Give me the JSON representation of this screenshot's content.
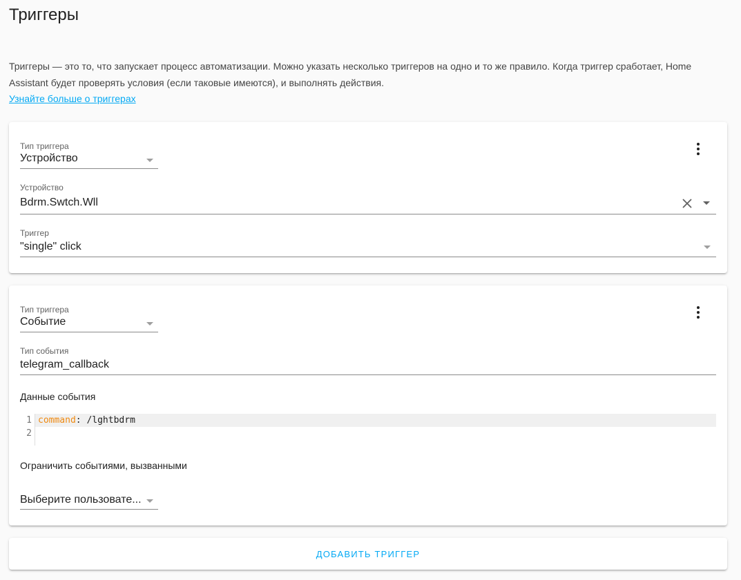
{
  "page": {
    "title": "Триггеры",
    "intro": "Триггеры — это то, что запускает процесс автоматизации. Можно указать несколько триггеров на одно и то же правило. Когда триггер сработает, Home Assistant будет проверять условия (если таковые имеются), и выполнять действия.",
    "learn_more": "Узнайте больше о триггерах"
  },
  "triggers": [
    {
      "type_label": "Тип триггера",
      "type_value": "Устройство",
      "device_label": "Устройство",
      "device_value": "Bdrm.Swtch.Wll",
      "trigger_label": "Триггер",
      "trigger_value": "\"single\" click"
    },
    {
      "type_label": "Тип триггера",
      "type_value": "Событие",
      "event_type_label": "Тип события",
      "event_type_value": "telegram_callback",
      "event_data_label": "Данные события",
      "code": {
        "line_numbers": [
          "1",
          "2"
        ],
        "key": "command",
        "value": ": /lghtbdrm"
      },
      "limit_label": "Ограничить событиями, вызванными",
      "user_select_value": "Выберите пользовате..."
    }
  ],
  "add_button": "Добавить триггер",
  "colors": {
    "accent": "#03a9f4",
    "code_key": "#ef8a12",
    "background": "#fafafa"
  },
  "icons": {
    "menu": "dots-vertical-icon",
    "dropdown": "menu-down-icon",
    "clear": "close-icon"
  }
}
